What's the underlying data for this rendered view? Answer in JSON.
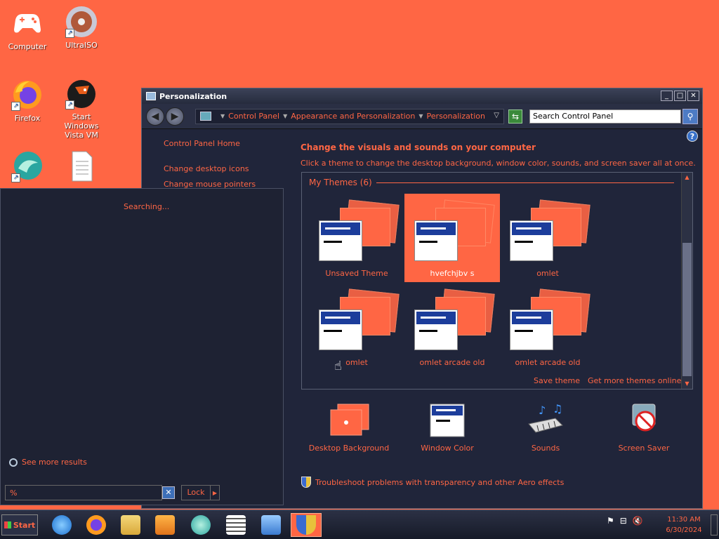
{
  "desktop": {
    "icons": [
      {
        "label": "Computer",
        "icon": "gamepad-icon"
      },
      {
        "label": "UltraISO",
        "icon": "disc-icon"
      },
      {
        "label": "Firefox",
        "icon": "firefox-icon"
      },
      {
        "label": "Start Windows Vista VM",
        "icon": "qemu-icon"
      },
      {
        "label": "",
        "icon": "app-icon"
      },
      {
        "label": "",
        "icon": "document-icon"
      }
    ]
  },
  "window": {
    "title": "Personalization",
    "address": {
      "crumbs": [
        "Control Panel",
        "Appearance and Personalization",
        "Personalization"
      ]
    },
    "search": {
      "placeholder": "Search Control Panel"
    },
    "sidebar": {
      "home": "Control Panel Home",
      "links": [
        "Change desktop icons",
        "Change mouse pointers"
      ]
    },
    "heading": "Change the visuals and sounds on your computer",
    "subheading": "Click a theme to change the desktop background, window color, sounds, and screen saver all at once.",
    "themes_group": "My Themes (6)",
    "themes": [
      {
        "name": "Unsaved Theme",
        "selected": false
      },
      {
        "name": "hvefchjbv s",
        "selected": true
      },
      {
        "name": "omlet",
        "selected": false
      },
      {
        "name": "omlet",
        "selected": false
      },
      {
        "name": "omlet arcade old",
        "selected": false
      },
      {
        "name": "omlet arcade old",
        "selected": false
      }
    ],
    "save_theme": "Save theme",
    "get_more": "Get more themes online",
    "bottom_items": [
      {
        "label": "Desktop Background",
        "icon": "desktop-background-icon"
      },
      {
        "label": "Window Color",
        "icon": "window-color-icon"
      },
      {
        "label": "Sounds",
        "icon": "sounds-icon"
      },
      {
        "label": "Screen Saver",
        "icon": "screen-saver-icon"
      }
    ],
    "troubleshoot": "Troubleshoot problems with transparency and other Aero effects"
  },
  "start_panel": {
    "status": "Searching...",
    "see_more": "See more results",
    "search_value": "%",
    "lock_label": "Lock"
  },
  "taskbar": {
    "start_label": "Start",
    "clock_time": "11:30 AM",
    "clock_date": "6/30/2024"
  },
  "colors": {
    "accent": "#ff6644",
    "window_bg": "#20253a"
  }
}
